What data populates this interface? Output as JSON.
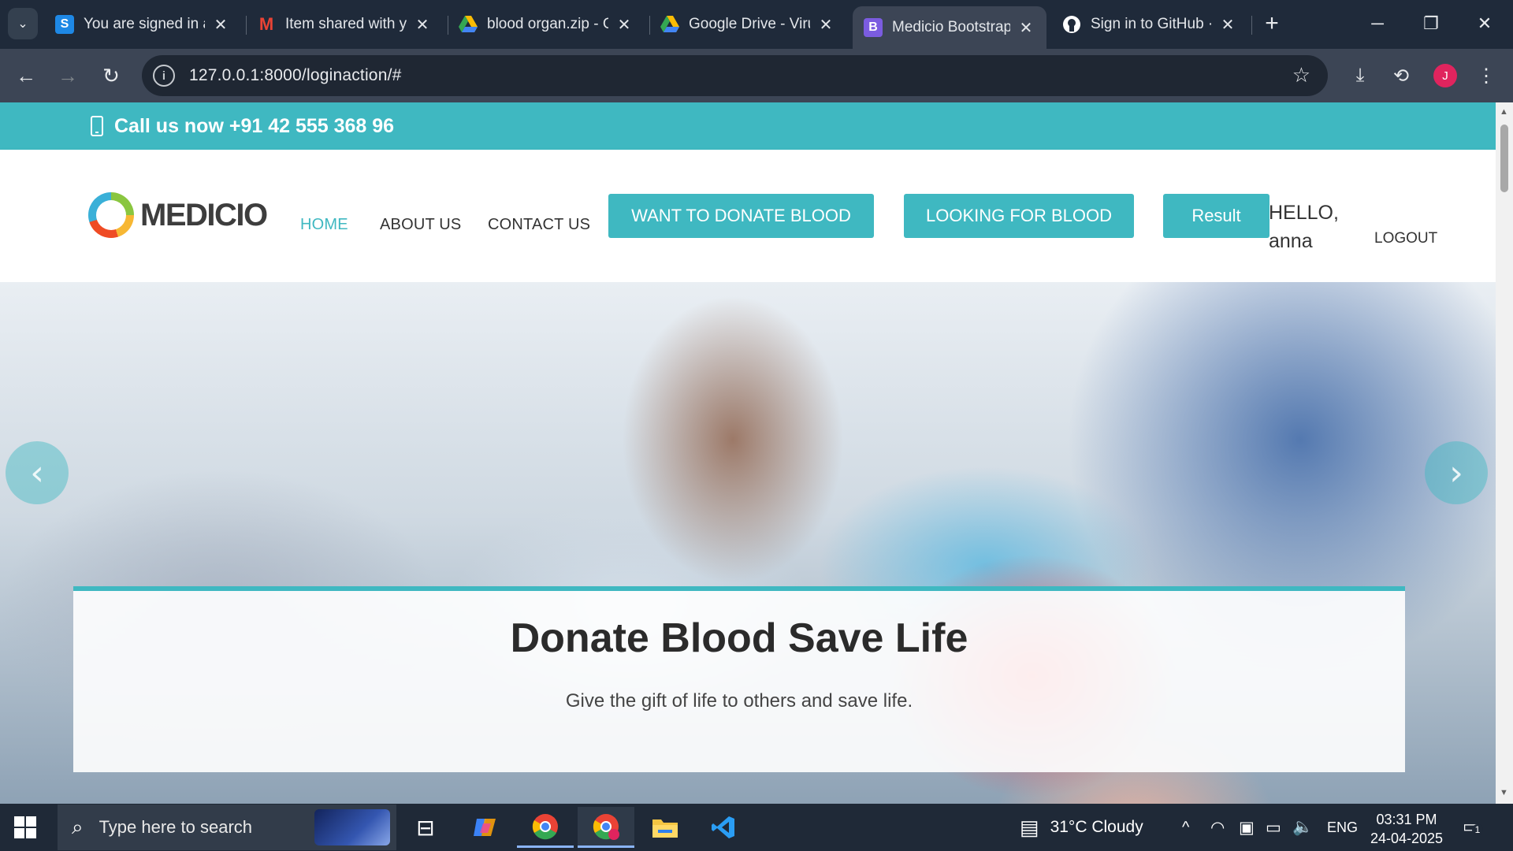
{
  "browser": {
    "tabs": [
      {
        "title": "You are signed in a",
        "favicon": "S",
        "favicon_color": "#1e88e5",
        "active": false
      },
      {
        "title": "Item shared with y",
        "favicon": "M",
        "favicon_color": "#ea4335",
        "active": false
      },
      {
        "title": "blood organ.zip - G",
        "favicon": "drive",
        "favicon_color": "#34a853",
        "active": false
      },
      {
        "title": "Google Drive - Viru",
        "favicon": "drive",
        "favicon_color": "#34a853",
        "active": false
      },
      {
        "title": "Medicio Bootstrap",
        "favicon": "B",
        "favicon_color": "#7b5ce0",
        "active": true
      },
      {
        "title": "Sign in to GitHub ·",
        "favicon": "github",
        "favicon_color": "#ffffff",
        "active": false
      }
    ],
    "url": "127.0.0.1:8000/loginaction/#",
    "profile_initial": "J"
  },
  "site": {
    "topbar": {
      "call_text": "Call us now +91 42 555 368 96"
    },
    "logo_text": "MEDICIO",
    "nav": {
      "home": "HOME",
      "about": "ABOUT US",
      "contact": "CONTACT US",
      "donate_button": "WANT TO DONATE BLOOD",
      "looking_button": "LOOKING FOR BLOOD",
      "result_button": "Result",
      "hello": "HELLO, anna",
      "logout": "LOGOUT"
    },
    "hero": {
      "title": "Donate Blood Save Life",
      "subtitle": "Give the gift of life to others and save life.",
      "prev": "‹",
      "next": "›",
      "active_slide": 1,
      "slide_count": 3
    },
    "accent_color": "#3fb8c1"
  },
  "taskbar": {
    "search_placeholder": "Type here to search",
    "weather": "31°C  Cloudy",
    "language": "ENG",
    "time": "03:31 PM",
    "date": "24-04-2025",
    "notification_count": "1"
  }
}
